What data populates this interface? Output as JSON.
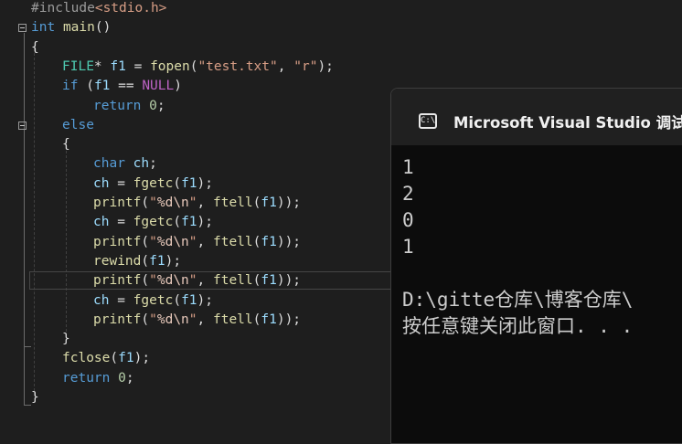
{
  "editor": {
    "lines": [
      [
        [
          "pp",
          "#include"
        ],
        [
          "str",
          "<stdio.h>"
        ]
      ],
      [
        [
          "kw",
          "int"
        ],
        [
          "plain",
          " "
        ],
        [
          "fn",
          "main"
        ],
        [
          "plain",
          "()"
        ]
      ],
      [
        [
          "plain",
          "{"
        ]
      ],
      [
        [
          "ty",
          "FILE"
        ],
        [
          "plain",
          "* "
        ],
        [
          "var",
          "f1"
        ],
        [
          "plain",
          " = "
        ],
        [
          "fn",
          "fopen"
        ],
        [
          "plain",
          "("
        ],
        [
          "str",
          "\"test.txt\""
        ],
        [
          "plain",
          ", "
        ],
        [
          "str",
          "\"r\""
        ],
        [
          "plain",
          ");"
        ]
      ],
      [
        [
          "kw",
          "if"
        ],
        [
          "plain",
          " ("
        ],
        [
          "var",
          "f1"
        ],
        [
          "plain",
          " == "
        ],
        [
          "mac",
          "NULL"
        ],
        [
          "plain",
          ")"
        ]
      ],
      [
        [
          "kw",
          "return"
        ],
        [
          "plain",
          " "
        ],
        [
          "num",
          "0"
        ],
        [
          "plain",
          ";"
        ]
      ],
      [
        [
          "kw",
          "else"
        ]
      ],
      [
        [
          "plain",
          "{"
        ]
      ],
      [
        [
          "kw",
          "char"
        ],
        [
          "plain",
          " "
        ],
        [
          "var",
          "ch"
        ],
        [
          "plain",
          ";"
        ]
      ],
      [
        [
          "var",
          "ch"
        ],
        [
          "plain",
          " = "
        ],
        [
          "fn",
          "fgetc"
        ],
        [
          "plain",
          "("
        ],
        [
          "var",
          "f1"
        ],
        [
          "plain",
          ");"
        ]
      ],
      [
        [
          "fn",
          "printf"
        ],
        [
          "plain",
          "("
        ],
        [
          "str",
          "\""
        ],
        [
          "esc",
          "%d\\n"
        ],
        [
          "str",
          "\""
        ],
        [
          "plain",
          ", "
        ],
        [
          "fn",
          "ftell"
        ],
        [
          "plain",
          "("
        ],
        [
          "var",
          "f1"
        ],
        [
          "plain",
          "));"
        ]
      ],
      [
        [
          "var",
          "ch"
        ],
        [
          "plain",
          " = "
        ],
        [
          "fn",
          "fgetc"
        ],
        [
          "plain",
          "("
        ],
        [
          "var",
          "f1"
        ],
        [
          "plain",
          ");"
        ]
      ],
      [
        [
          "fn",
          "printf"
        ],
        [
          "plain",
          "("
        ],
        [
          "str",
          "\""
        ],
        [
          "esc",
          "%d\\n"
        ],
        [
          "str",
          "\""
        ],
        [
          "plain",
          ", "
        ],
        [
          "fn",
          "ftell"
        ],
        [
          "plain",
          "("
        ],
        [
          "var",
          "f1"
        ],
        [
          "plain",
          "));"
        ]
      ],
      [
        [
          "fn",
          "rewind"
        ],
        [
          "plain",
          "("
        ],
        [
          "var",
          "f1"
        ],
        [
          "plain",
          ");"
        ]
      ],
      [
        [
          "fn",
          "printf"
        ],
        [
          "plain",
          "("
        ],
        [
          "str",
          "\""
        ],
        [
          "esc",
          "%d\\n"
        ],
        [
          "str",
          "\""
        ],
        [
          "plain",
          ", "
        ],
        [
          "fn",
          "ftell"
        ],
        [
          "plain",
          "("
        ],
        [
          "var",
          "f1"
        ],
        [
          "plain",
          "));"
        ]
      ],
      [
        [
          "var",
          "ch"
        ],
        [
          "plain",
          " = "
        ],
        [
          "fn",
          "fgetc"
        ],
        [
          "plain",
          "("
        ],
        [
          "var",
          "f1"
        ],
        [
          "plain",
          ");"
        ]
      ],
      [
        [
          "fn",
          "printf"
        ],
        [
          "plain",
          "("
        ],
        [
          "str",
          "\""
        ],
        [
          "esc",
          "%d\\n"
        ],
        [
          "str",
          "\""
        ],
        [
          "plain",
          ", "
        ],
        [
          "fn",
          "ftell"
        ],
        [
          "plain",
          "("
        ],
        [
          "var",
          "f1"
        ],
        [
          "plain",
          "));"
        ]
      ],
      [
        [
          "plain",
          "}"
        ]
      ],
      [
        [
          "fn",
          "fclose"
        ],
        [
          "plain",
          "("
        ],
        [
          "var",
          "f1"
        ],
        [
          "plain",
          ");"
        ]
      ],
      [
        [
          "kw",
          "return"
        ],
        [
          "plain",
          " "
        ],
        [
          "num",
          "0"
        ],
        [
          "plain",
          ";"
        ]
      ],
      [
        [
          "plain",
          "}"
        ]
      ]
    ]
  },
  "console": {
    "title": "Microsoft Visual Studio 调试控制台",
    "icon_text": "C:\\",
    "output": [
      "1",
      "2",
      "0",
      "1",
      "",
      "D:\\gitte仓库\\博客仓库\\",
      "按任意键关闭此窗口. . ."
    ]
  },
  "colors": {
    "keyword": "#569cd6",
    "function": "#dcdcaa",
    "type": "#4ec9b0",
    "variable": "#9cdcfe",
    "string": "#d69d85",
    "number": "#b5cea8",
    "macro": "#bd63c5",
    "preprocessor": "#9b9b9b"
  }
}
